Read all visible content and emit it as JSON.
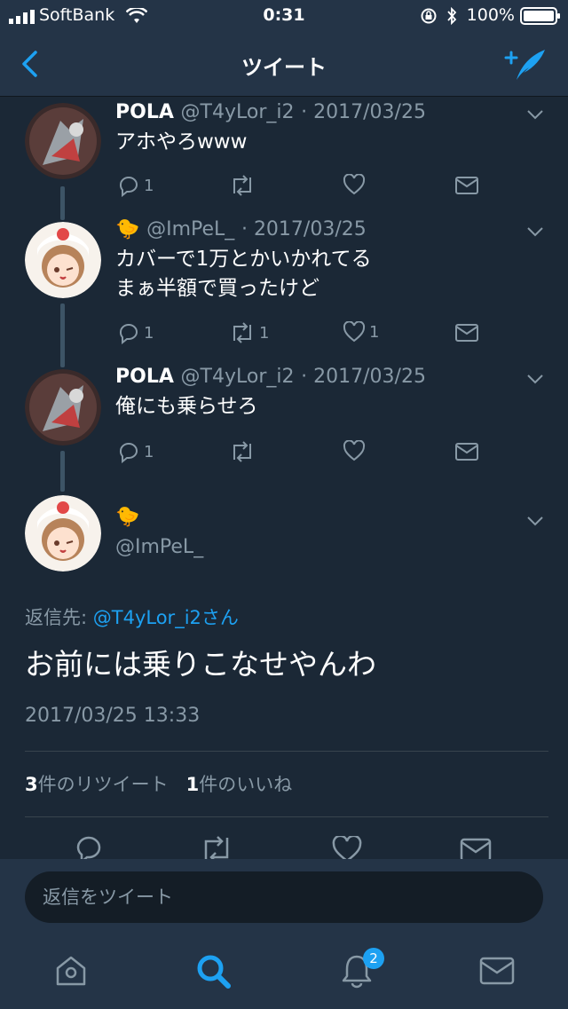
{
  "status_bar": {
    "carrier": "SoftBank",
    "time": "0:31",
    "battery": "100%"
  },
  "nav": {
    "title": "ツイート"
  },
  "colors": {
    "background": "#1b2836",
    "bar": "#243447",
    "accent": "#1da1f2",
    "muted": "#8899a6"
  },
  "thread": [
    {
      "name": "POLA",
      "handle": "@T4yLor_i2",
      "date": "· 2017/03/25",
      "text": "アホやろwww",
      "reply_count": "1",
      "retweet_count": "",
      "like_count": ""
    },
    {
      "name": "🐤",
      "handle": "@ImPeL_",
      "date": "· 2017/03/25",
      "text": "カバーで1万とかいかれてる\nまぁ半額で買ったけど",
      "reply_count": "1",
      "retweet_count": "1",
      "like_count": "1"
    },
    {
      "name": "POLA",
      "handle": "@T4yLor_i2",
      "date": "· 2017/03/25",
      "text": "俺にも乗らせろ",
      "reply_count": "1",
      "retweet_count": "",
      "like_count": ""
    }
  ],
  "main_tweet": {
    "name": "🐤",
    "handle": "@ImPeL_",
    "reply_to_prefix": "返信先: ",
    "reply_to_link": "@T4yLor_i2さん",
    "text": "お前には乗りこなせやんわ",
    "timestamp": "2017/03/25 13:33",
    "retweets_count": "3",
    "retweets_label": "件のリツイート",
    "likes_count": "1",
    "likes_label": "件のいいね"
  },
  "composer": {
    "placeholder": "返信をツイート"
  },
  "tab_bar": {
    "notification_badge": "2"
  }
}
